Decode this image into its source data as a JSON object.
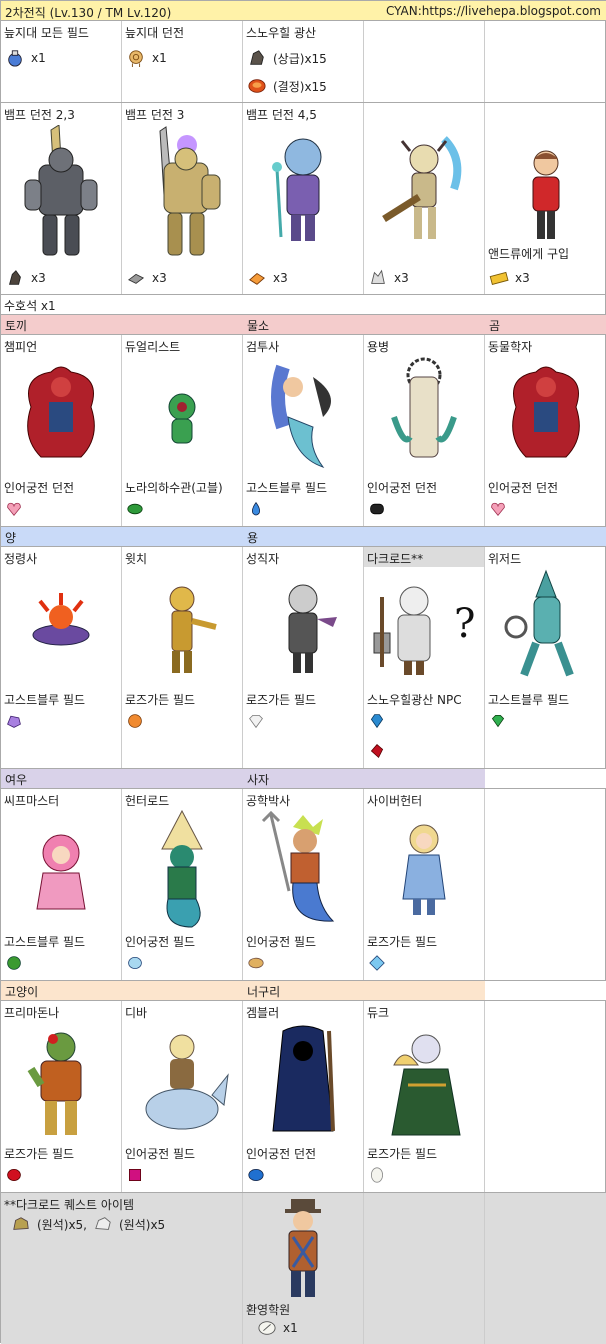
{
  "title": {
    "left": "2차전직 (Lv.130 / TM Lv.120)",
    "right": "CYAN:https://livehepa.blogspot.com"
  },
  "top": {
    "headers": [
      "늪지대 모든 필드",
      "늪지대 던전",
      "스노우힐 광산"
    ],
    "items": [
      {
        "qty": "x1"
      },
      {
        "qty": "x1"
      },
      {
        "qty": "(상급)x15"
      },
      {
        "qty": "(결정)x15"
      }
    ]
  },
  "vamp": {
    "headers": [
      "뱀프 던전 2,3",
      "뱀프 던전 3",
      "뱀프 던전 4,5"
    ],
    "andrew": "앤드류에게 구입",
    "qty": [
      "x3",
      "x3",
      "x3",
      "x3",
      "x3"
    ]
  },
  "guardian": "수호석 x1",
  "groups": {
    "rabbit": "토끼",
    "water": "물소",
    "bear": "곰",
    "sheep": "양",
    "dragon": "용",
    "fox": "여우",
    "lion": "사자",
    "cat": "고양이",
    "raccoon": "너구리"
  },
  "jobs1": {
    "names": [
      "챔피언",
      "듀얼리스트",
      "검투사",
      "용병",
      "동물학자"
    ],
    "places": [
      "인어궁전 던전",
      "노라의하수관(고블)",
      "고스트블루 필드",
      "인어궁전 던전",
      "인어궁전 던전"
    ]
  },
  "jobs2": {
    "names": [
      "정령사",
      "윗치",
      "성직자",
      "다크로드**",
      "위저드"
    ],
    "places": [
      "고스트블루 필드",
      "로즈가든 필드",
      "로즈가든 필드",
      "스노우힐광산 NPC",
      "고스트블루 필드"
    ]
  },
  "jobs3": {
    "names": [
      "씨프마스터",
      "헌터로드",
      "공학박사",
      "사이버헌터"
    ],
    "places": [
      "고스트블루 필드",
      "인어궁전 필드",
      "인어궁전 필드",
      "로즈가든 필드"
    ]
  },
  "jobs4": {
    "names": [
      "프리마돈나",
      "디바",
      "겜블러",
      "듀크"
    ],
    "places": [
      "로즈가든 필드",
      "인어궁전 필드",
      "인어궁전 던전",
      "로즈가든 필드"
    ]
  },
  "footer": {
    "note": "**다크로드 퀘스트 아이템",
    "ore1": "(원석)x5,",
    "ore2": "(원석)x5",
    "npc": "환영학원",
    "npc_qty": "x1"
  },
  "colors": {
    "title": "#fff2a8",
    "rabbit": "#f4cccc",
    "sheep": "#c9daf8",
    "fox": "#d9d2e9",
    "cat": "#fce5cd",
    "grey": "#dcdcdc"
  }
}
